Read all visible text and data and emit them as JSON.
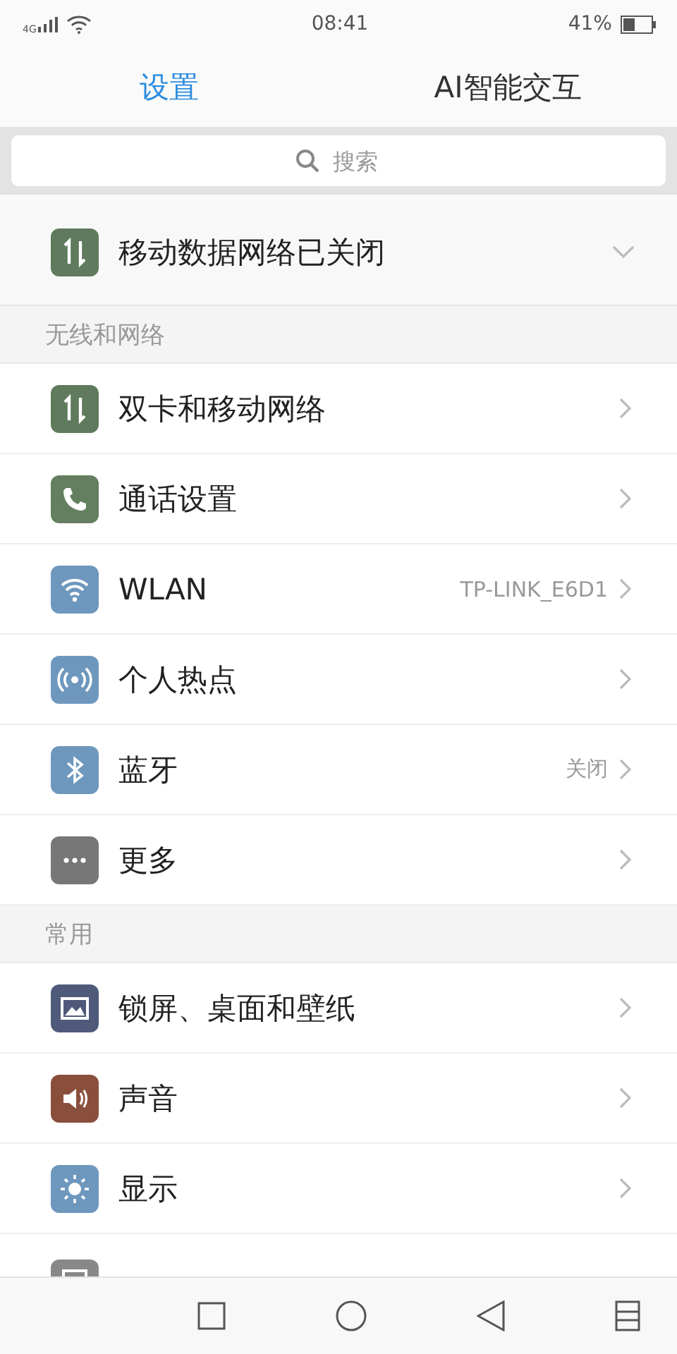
{
  "status_bar": {
    "network": "4G",
    "time": "08:41",
    "battery": "41%"
  },
  "tabs": [
    {
      "label": "设置",
      "selected": true
    },
    {
      "label": "AI智能交互",
      "selected": false
    }
  ],
  "search": {
    "placeholder": "搜索"
  },
  "banner": {
    "kind": "data",
    "color": "#5f7a5c",
    "label": "移动数据网络已关闭",
    "expanded": false
  },
  "sections": [
    {
      "title": "无线和网络",
      "items": [
        {
          "kind": "data",
          "color": "#5f7a5c",
          "label": "双卡和移动网络"
        },
        {
          "kind": "phone",
          "color": "#647f5f",
          "label": "通话设置"
        },
        {
          "kind": "wifi",
          "color": "#6e97bd",
          "label": "WLAN",
          "value": "TP-LINK_E6D1"
        },
        {
          "kind": "hotspot",
          "color": "#6e97bd",
          "label": "个人热点"
        },
        {
          "kind": "bluetooth",
          "color": "#6e97bd",
          "label": "蓝牙",
          "value": "关闭"
        },
        {
          "kind": "more",
          "color": "#777777",
          "label": "更多"
        }
      ]
    },
    {
      "title": "常用",
      "items": [
        {
          "kind": "wallpaper",
          "color": "#4f5a7a",
          "label": "锁屏、桌面和壁纸"
        },
        {
          "kind": "sound",
          "color": "#8a4f3c",
          "label": "声音"
        },
        {
          "kind": "display",
          "color": "#6e97bd",
          "label": "显示"
        }
      ]
    }
  ]
}
